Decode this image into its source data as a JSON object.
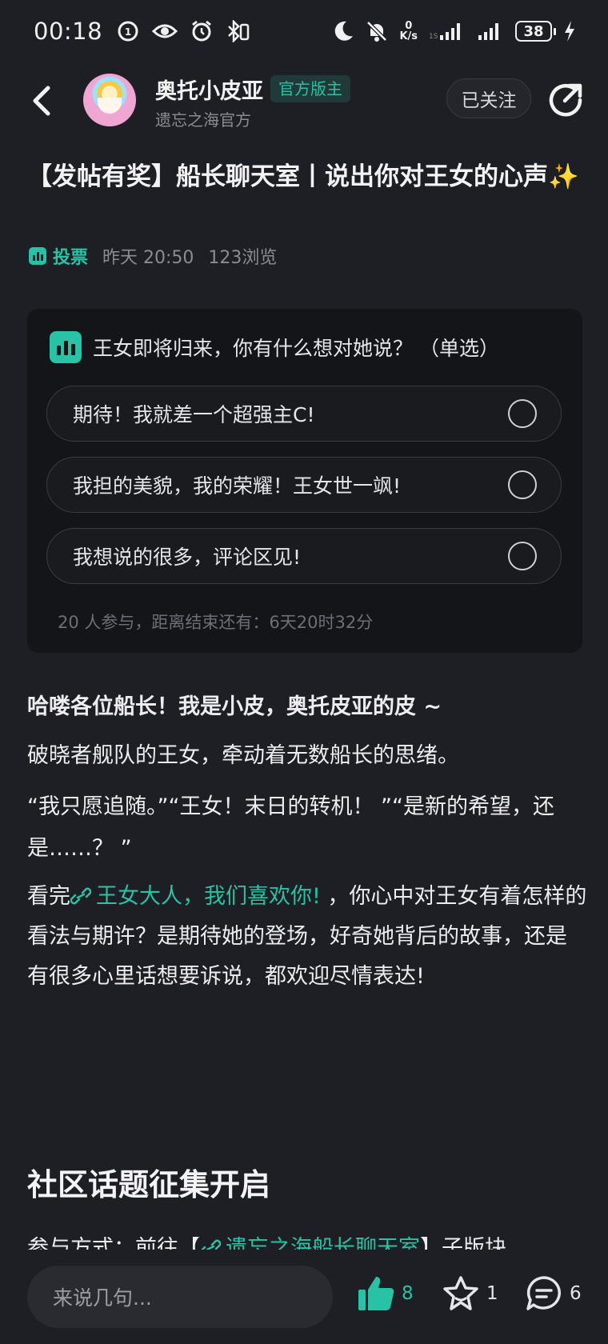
{
  "status_bar": {
    "time": "00:18",
    "net_speed_value": "0",
    "net_speed_unit": "K/s",
    "battery": "38",
    "icons": [
      "app-notification-icon",
      "eye-icon",
      "alarm-icon",
      "bluetooth-icon",
      "moon-icon",
      "mute-bell-icon",
      "signal-icon",
      "signal-icon",
      "charging-icon"
    ]
  },
  "header": {
    "author_name": "奥托小皮亚",
    "badge": "官方版主",
    "author_sub": "遗忘之海官方",
    "follow_label": "已关注"
  },
  "post": {
    "title": "【发帖有奖】船长聊天室丨说出你对王女的心声✨",
    "type_label": "投票",
    "time": "昨天 20:50",
    "views": "123浏览"
  },
  "poll": {
    "question": "王女即将归来，你有什么想对她说？ （单选）",
    "options": [
      {
        "label": "期待！我就差一个超强主C!"
      },
      {
        "label": "我担的美貌，我的荣耀！王女世一飒!"
      },
      {
        "label": "我想说的很多，评论区见!"
      }
    ],
    "footer": "20 人参与，距离结束还有：6天20时32分"
  },
  "body": {
    "p1": "哈喽各位船长！我是小皮，奥托皮亚的皮 ~",
    "p2": "破晓者舰队的王女，牵动着无数船长的思绪。",
    "p3": "“我只愿追随。”“王女！末日的转机！ ”“是新的希望，还是……？ ”",
    "p4_prefix": "看完",
    "p4_link": "王女大人，我们喜欢你!",
    "p4_suffix": " ，你心中对王女有着怎样的看法与期许？是期待她的登场，好奇她背后的故事，还是有很多心里话想要诉说，都欢迎尽情表达!",
    "section_title": "社区话题征集开启",
    "cut_prefix": "参与方式：前往【",
    "cut_link": "遗忘之海船长聊天室",
    "cut_suffix": "】子版块"
  },
  "bottom_bar": {
    "input_placeholder": "来说几句...",
    "likes": "8",
    "favorites": "1",
    "comments": "6"
  },
  "colors": {
    "background": "#1e1f24",
    "accent": "#28c2a6",
    "card": "#141518"
  }
}
